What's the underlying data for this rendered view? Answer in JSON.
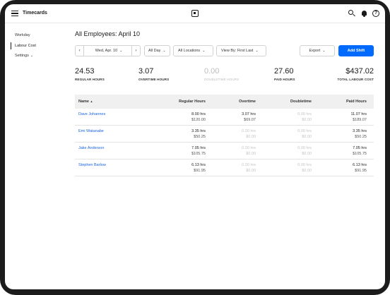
{
  "app": {
    "title": "Timecards"
  },
  "sidebar": {
    "items": [
      {
        "label": "Workday"
      },
      {
        "label": "Labour Cost"
      },
      {
        "label": "Settings"
      }
    ]
  },
  "page": {
    "title": "All Employees: April 10"
  },
  "filters": {
    "date": "Wed, Apr. 10",
    "time_range": "All Day",
    "locations": "All Locations",
    "view_by": "View By: First Last",
    "export_label": "Export",
    "add_shift_label": "Add Shift"
  },
  "stats": [
    {
      "value": "24.53",
      "label": "REGULAR HOURS"
    },
    {
      "value": "3.07",
      "label": "OVERTIME HOURS"
    },
    {
      "value": "0.00",
      "label": "DOUBLETIME HOURS"
    },
    {
      "value": "27.60",
      "label": "PAID HOURS"
    },
    {
      "value": "$437.02",
      "label": "TOTAL LABOUR COST"
    }
  ],
  "table": {
    "columns": [
      "Name",
      "Regular Hours",
      "Overtime",
      "Doubletime",
      "Paid Hours"
    ],
    "sort_indicator": "▲",
    "rows": [
      {
        "name": "Dave Johannes",
        "regular": [
          "8.00 hrs",
          "$120.00"
        ],
        "overtime": [
          "3.07 hrs",
          "$69.07"
        ],
        "doubletime": [
          "0.00 hrs",
          "$0.00"
        ],
        "paid": [
          "11.07 hrs",
          "$189.07"
        ]
      },
      {
        "name": "Emi Watanabe",
        "regular": [
          "3.35 hrs",
          "$50.25"
        ],
        "overtime": [
          "0.00 hrs",
          "$0.00"
        ],
        "doubletime": [
          "0.00 hrs",
          "$0.00"
        ],
        "paid": [
          "3.35 hrs",
          "$50.25"
        ]
      },
      {
        "name": "Jake Anderson",
        "regular": [
          "7.05 hrs",
          "$105.75"
        ],
        "overtime": [
          "0.00 hrs",
          "$0.00"
        ],
        "doubletime": [
          "0.00 hrs",
          "$0.00"
        ],
        "paid": [
          "7.05 hrs",
          "$105.75"
        ]
      },
      {
        "name": "Stephen Barlow",
        "regular": [
          "6.13 hrs",
          "$91.95"
        ],
        "overtime": [
          "0.00 hrs",
          "$0.00"
        ],
        "doubletime": [
          "0.00 hrs",
          "$0.00"
        ],
        "paid": [
          "6.13 hrs",
          "$91.95"
        ]
      }
    ]
  },
  "colors": {
    "accent": "#006aff",
    "link": "#1a66e0",
    "muted": "#bdbdbd"
  }
}
